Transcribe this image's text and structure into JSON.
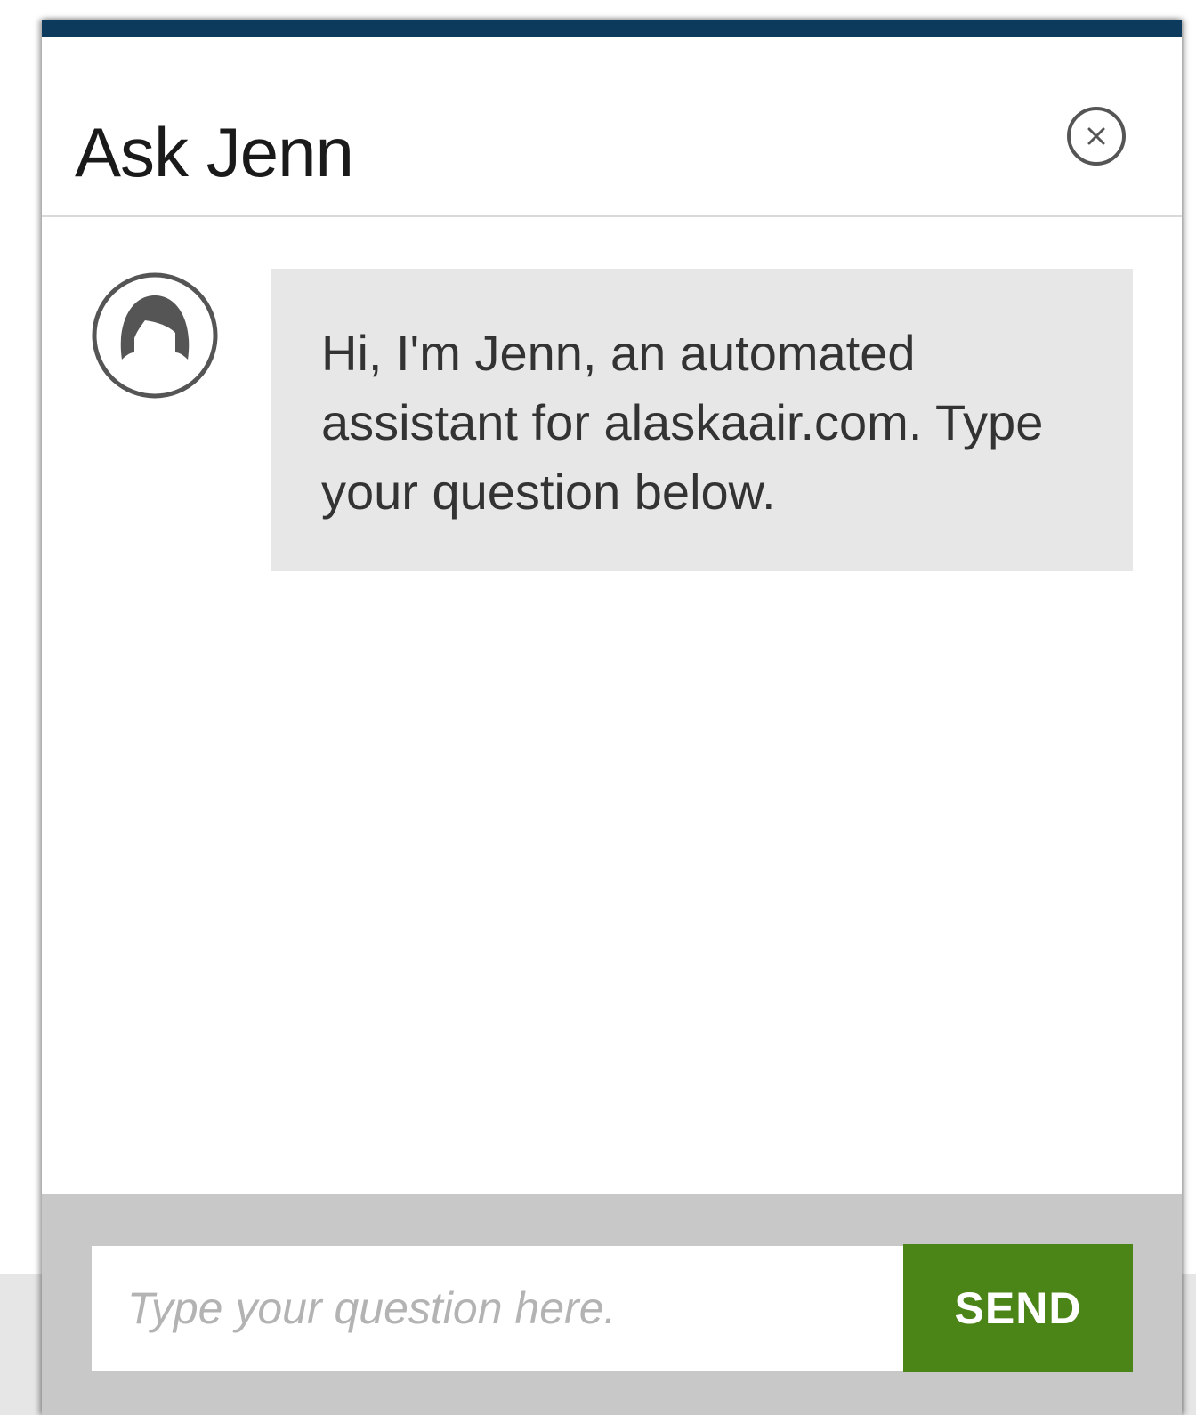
{
  "chat": {
    "title": "Ask Jenn",
    "close_icon": "close-circle-icon",
    "avatar_icon": "female-avatar-icon",
    "messages": [
      {
        "sender": "Jenn",
        "text": "Hi, I'm Jenn, an automated assistant for alaskaair.com. Type your question below."
      }
    ],
    "input": {
      "placeholder": "Type your question here.",
      "value": ""
    },
    "send_label": "SEND"
  },
  "colors": {
    "top_bar": "#0b3a5c",
    "send_button": "#4b8417",
    "bubble": "#e7e7e7",
    "input_area": "#c8c8c8"
  }
}
